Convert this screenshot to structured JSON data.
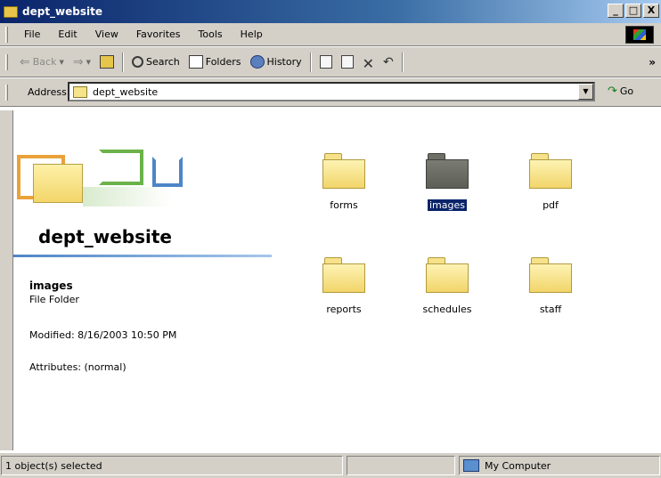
{
  "window": {
    "title": "dept_website",
    "buttons": [
      "_",
      "□",
      "X"
    ]
  },
  "menu": [
    "File",
    "Edit",
    "View",
    "Favorites",
    "Tools",
    "Help"
  ],
  "toolbar": {
    "back": "Back",
    "search": "Search",
    "folders": "Folders",
    "history": "History",
    "overflow": "»"
  },
  "address": {
    "label": "Address",
    "value": "dept_website",
    "go": "Go"
  },
  "panel": {
    "title": "dept_website",
    "selected_name": "images",
    "selected_type": "File Folder",
    "modified": "Modified: 8/16/2003 10:50 PM",
    "attributes": "Attributes: (normal)"
  },
  "items": [
    {
      "label": "forms",
      "selected": false
    },
    {
      "label": "images",
      "selected": true
    },
    {
      "label": "pdf",
      "selected": false
    },
    {
      "label": "reports",
      "selected": false
    },
    {
      "label": "schedules",
      "selected": false
    },
    {
      "label": "staff",
      "selected": false
    }
  ],
  "status": {
    "selection": "1 object(s) selected",
    "zone": "My Computer"
  }
}
